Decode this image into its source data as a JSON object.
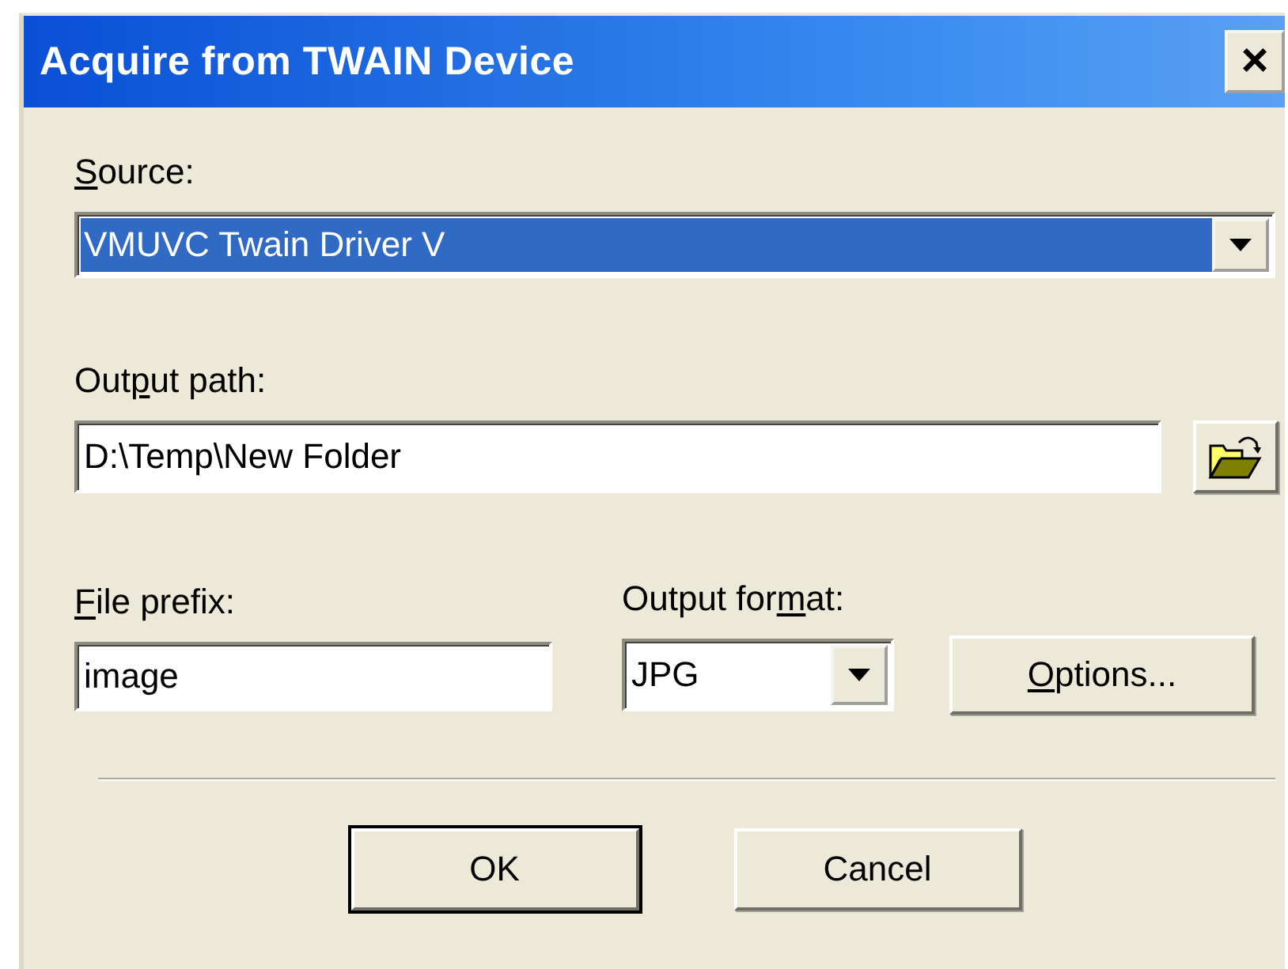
{
  "window": {
    "title": "Acquire from TWAIN Device",
    "close": "×"
  },
  "source": {
    "label": [
      {
        "text": "S",
        "underlined": true
      },
      {
        "text": "ource:",
        "underlined": false
      }
    ],
    "value": "VMUVC Twain Driver V",
    "highlighted": true
  },
  "output_path": {
    "label": [
      {
        "text": "Out",
        "underlined": false
      },
      {
        "text": "p",
        "underlined": true
      },
      {
        "text": "ut path:",
        "underlined": false
      }
    ],
    "value": "D:\\Temp\\New Folder"
  },
  "file_prefix": {
    "label": [
      {
        "text": "F",
        "underlined": true
      },
      {
        "text": "ile prefix:",
        "underlined": false
      }
    ],
    "value": "image"
  },
  "output_format": {
    "label": [
      {
        "text": "Output for",
        "underlined": false
      },
      {
        "text": "m",
        "underlined": true
      },
      {
        "text": "at:",
        "underlined": false
      }
    ],
    "value": "JPG"
  },
  "options_button": {
    "label": [
      {
        "text": "O",
        "underlined": true
      },
      {
        "text": "ptions...",
        "underlined": false
      }
    ]
  },
  "buttons": [
    {
      "label": "OK",
      "default": true
    },
    {
      "label": "Cancel",
      "default": false
    }
  ]
}
